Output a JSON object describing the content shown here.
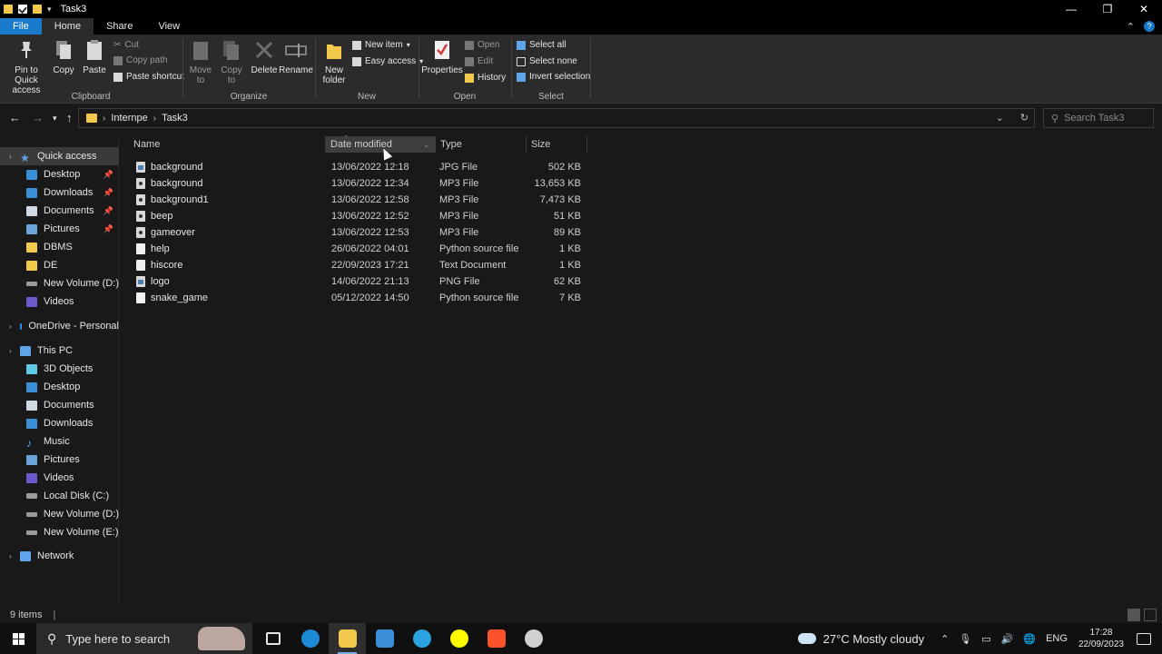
{
  "window": {
    "title": "Task3",
    "qat_dropdown": "▾",
    "minimize": "—",
    "restore": "❐",
    "close": "✕"
  },
  "tabs": [
    {
      "label": "File"
    },
    {
      "label": "Home"
    },
    {
      "label": "Share"
    },
    {
      "label": "View"
    }
  ],
  "ribbon": {
    "clipboard": {
      "label": "Clipboard",
      "pin": "Pin to Quick\naccess",
      "copy": "Copy",
      "paste": "Paste",
      "cut": "Cut",
      "copy_path": "Copy path",
      "paste_shortcut": "Paste shortcut"
    },
    "organize": {
      "label": "Organize",
      "move_to": "Move\nto",
      "copy_to": "Copy\nto",
      "delete": "Delete",
      "rename": "Rename"
    },
    "new": {
      "label": "New",
      "new_folder": "New\nfolder",
      "new_item": "New item",
      "easy_access": "Easy access"
    },
    "open": {
      "label": "Open",
      "properties": "Properties",
      "open": "Open",
      "edit": "Edit",
      "history": "History"
    },
    "select": {
      "label": "Select",
      "select_all": "Select all",
      "select_none": "Select none",
      "invert": "Invert selection"
    }
  },
  "address": {
    "crumbs": [
      "Internpe",
      "Task3"
    ],
    "search_placeholder": "Search Task3"
  },
  "nav": {
    "quick_access": "Quick access",
    "quick_items": [
      "Desktop",
      "Downloads",
      "Documents",
      "Pictures",
      "DBMS",
      "DE",
      "New Volume (D:)",
      "Videos"
    ],
    "onedrive": "OneDrive - Personal",
    "this_pc": "This PC",
    "pc_items": [
      "3D Objects",
      "Desktop",
      "Documents",
      "Downloads",
      "Music",
      "Pictures",
      "Videos",
      "Local Disk (C:)",
      "New Volume (D:)",
      "New Volume (E:)"
    ],
    "network": "Network"
  },
  "columns": {
    "name": "Name",
    "date": "Date modified",
    "type": "Type",
    "size": "Size"
  },
  "files": [
    {
      "name": "background",
      "date": "13/06/2022 12:18",
      "type": "JPG File",
      "size": "502 KB",
      "icon": "jpg"
    },
    {
      "name": "background",
      "date": "13/06/2022 12:34",
      "type": "MP3 File",
      "size": "13,653 KB",
      "icon": "mp3"
    },
    {
      "name": "background1",
      "date": "13/06/2022 12:58",
      "type": "MP3 File",
      "size": "7,473 KB",
      "icon": "mp3"
    },
    {
      "name": "beep",
      "date": "13/06/2022 12:52",
      "type": "MP3 File",
      "size": "51 KB",
      "icon": "mp3"
    },
    {
      "name": "gameover",
      "date": "13/06/2022 12:53",
      "type": "MP3 File",
      "size": "89 KB",
      "icon": "mp3"
    },
    {
      "name": "help",
      "date": "26/06/2022 04:01",
      "type": "Python source file",
      "size": "1 KB",
      "icon": "py"
    },
    {
      "name": "hiscore",
      "date": "22/09/2023 17:21",
      "type": "Text Document",
      "size": "1 KB",
      "icon": "txt"
    },
    {
      "name": "logo",
      "date": "14/06/2022 21:13",
      "type": "PNG File",
      "size": "62 KB",
      "icon": "png"
    },
    {
      "name": "snake_game",
      "date": "05/12/2022 14:50",
      "type": "Python source file",
      "size": "7 KB",
      "icon": "py"
    }
  ],
  "status": {
    "items": "9 items",
    "divider": "|"
  },
  "taskbar": {
    "search_placeholder": "Type here to search",
    "weather": "27°C  Mostly cloudy",
    "lang": "ENG",
    "time": "17:28",
    "date": "22/09/2023",
    "apps": [
      {
        "name": "task-view",
        "color": "#101010"
      },
      {
        "name": "edge",
        "color": "#1c8ad6"
      },
      {
        "name": "file-explorer",
        "color": "#f2c94c"
      },
      {
        "name": "mail",
        "color": "#3b8fd9"
      },
      {
        "name": "app-blue",
        "color": "#2aa3e0"
      },
      {
        "name": "snapchat",
        "color": "#fffc00"
      },
      {
        "name": "brave",
        "color": "#fb542b"
      },
      {
        "name": "app-record",
        "color": "#d0d0d0"
      }
    ]
  },
  "colors": {
    "accent": "#1979ca",
    "folder": "#f2c94c",
    "background": "#191919"
  }
}
